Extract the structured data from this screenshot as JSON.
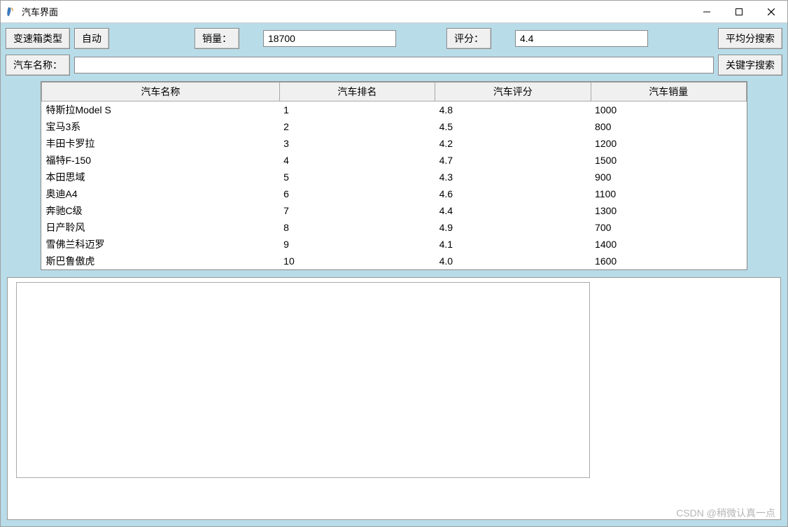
{
  "window": {
    "title": "汽车界面"
  },
  "toolbar1": {
    "transmission_label": "变速箱类型",
    "transmission_value_btn": "自动",
    "sales_label": "销量：",
    "sales_value": "18700",
    "rating_label": "评分：",
    "rating_value": "4.4",
    "avg_search_btn": "平均分搜索"
  },
  "toolbar2": {
    "name_label": "汽车名称：",
    "name_value": "",
    "keyword_search_btn": "关键字搜索"
  },
  "table": {
    "headers": [
      "汽车名称",
      "汽车排名",
      "汽车评分",
      "汽车销量"
    ],
    "rows": [
      {
        "name": "特斯拉Model S",
        "rank": "1",
        "rating": "4.8",
        "sales": "1000"
      },
      {
        "name": "宝马3系",
        "rank": "2",
        "rating": "4.5",
        "sales": "800"
      },
      {
        "name": "丰田卡罗拉",
        "rank": "3",
        "rating": "4.2",
        "sales": "1200"
      },
      {
        "name": "福特F-150",
        "rank": "4",
        "rating": "4.7",
        "sales": "1500"
      },
      {
        "name": "本田思域",
        "rank": "5",
        "rating": "4.3",
        "sales": "900"
      },
      {
        "name": "奥迪A4",
        "rank": "6",
        "rating": "4.6",
        "sales": "1100"
      },
      {
        "name": "奔驰C级",
        "rank": "7",
        "rating": "4.4",
        "sales": "1300"
      },
      {
        "name": "日产聆风",
        "rank": "8",
        "rating": "4.9",
        "sales": "700"
      },
      {
        "name": "雪佛兰科迈罗",
        "rank": "9",
        "rating": "4.1",
        "sales": "1400"
      },
      {
        "name": "斯巴鲁傲虎",
        "rank": "10",
        "rating": "4.0",
        "sales": "1600"
      }
    ]
  },
  "watermark": "CSDN @稍微认真一点"
}
